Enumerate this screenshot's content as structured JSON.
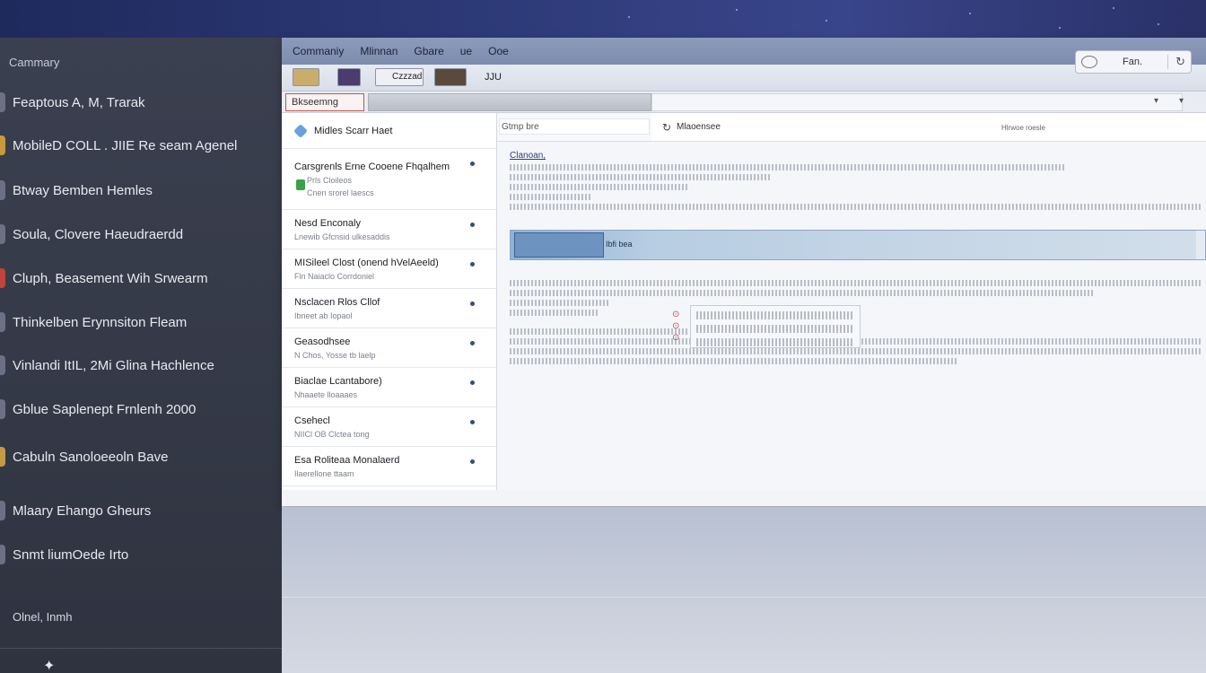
{
  "sidebar": {
    "header": "Cammary",
    "items": [
      {
        "label": "Feaptous A, M, Trarak",
        "color": "#6b7084"
      },
      {
        "label": "MobileD COLL . JIIE Re seam Agenel",
        "color": "#c79a3a"
      },
      {
        "label": "Btway Bemben Hemles",
        "color": "#6b7084"
      },
      {
        "label": "Soula, Clovere Haeudraerdd",
        "color": "#6b7084"
      },
      {
        "label": "Cluph, Beasement Wih Srwearm",
        "color": "#c0443b"
      },
      {
        "label": "Thinkelben Erynnsiton Fleam",
        "color": "#6b7084"
      },
      {
        "label": "Vinlandi ItIL, 2Mi Glina Hachlence",
        "color": "#6b7084"
      },
      {
        "label": "Gblue Saplenept Frnlenh 2000",
        "color": "#6b7084"
      },
      {
        "label": "Cabuln Sanoloeeoln Bave",
        "color": "#c49a42"
      },
      {
        "label": "Mlaary Ehango Gheurs",
        "color": "#6b7084"
      },
      {
        "label": "Snmt liumOede Irto",
        "color": "#6b7084"
      }
    ],
    "footer": "Olnel, Inmh"
  },
  "menubar": [
    "Commaniy",
    "Mlinnan",
    "Gbare",
    "ue",
    "Ooe"
  ],
  "toolbar": {
    "btn_text": "Czzzad",
    "btn_text2": "JJU",
    "right_label": "Fan."
  },
  "addressbar": {
    "label": "Bkseemng"
  },
  "listpane": {
    "header": "Midles Scarr Haet",
    "items": [
      {
        "title": "Carsgrenls Erne Cooene Fhqalhem",
        "sub1": "Prls Cloileos",
        "sub2": "Cnen srorel laescs"
      },
      {
        "title": "Nesd Enconaly",
        "sub": "Lnewib Gfcnsid ulkesaddis"
      },
      {
        "title": "MISileel Clost (onend hVelAeeld)",
        "sub": "Fln Naiaclo Corrdoniel"
      },
      {
        "title": "Nsclacen Rlos Cllof",
        "sub": "Ibneet ab Iopaol"
      },
      {
        "title": "Geasodhsee",
        "sub": "N Chos, Yosse tb laelp"
      },
      {
        "title": "Biaclae Lcantabore)",
        "sub": "Nhaaete lloaaaes"
      },
      {
        "title": "Csehecl",
        "sub": "NIICl OB Clctea tong"
      },
      {
        "title": "Esa Roliteaa Monalaerd",
        "sub": "Ilaerellone ttaam"
      }
    ]
  },
  "search": {
    "placeholder": "Gtmp bre"
  },
  "readpane": {
    "subject": "Mlaoensee",
    "right_meta": "Hlrwoe roesle",
    "greeting": "Clanoan,",
    "highlight_label": "Ibfi bea"
  }
}
